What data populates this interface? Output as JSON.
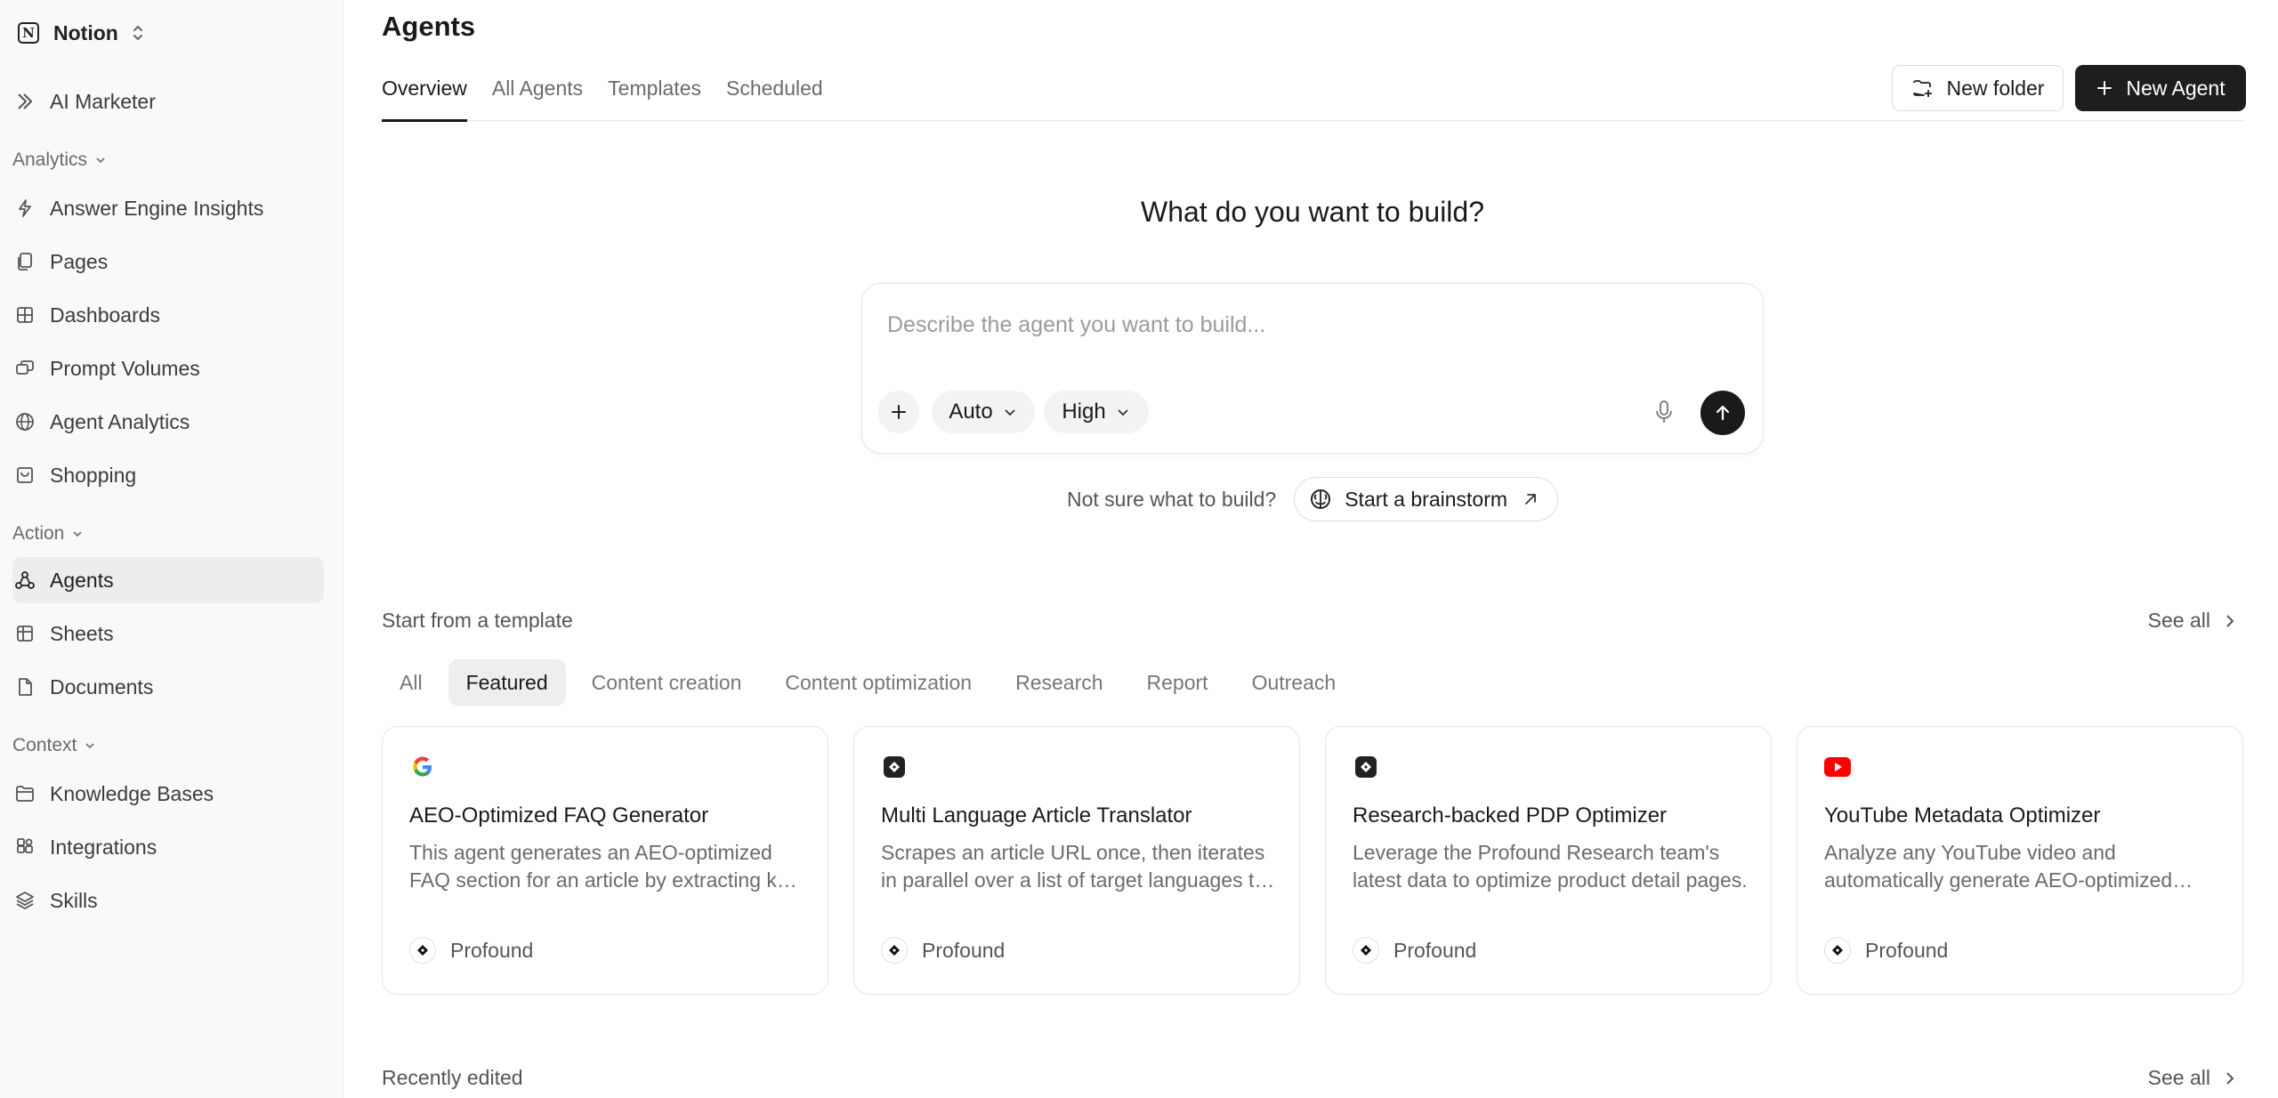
{
  "workspace": {
    "name": "Notion"
  },
  "sidebar": {
    "top_item": {
      "label": "AI Marketer",
      "icon": "profound-icon"
    },
    "sections": [
      {
        "label": "Analytics",
        "items": [
          {
            "label": "Answer Engine Insights",
            "icon": "lightning-icon"
          },
          {
            "label": "Pages",
            "icon": "pages-icon"
          },
          {
            "label": "Dashboards",
            "icon": "grid-icon"
          },
          {
            "label": "Prompt Volumes",
            "icon": "chat-icon"
          },
          {
            "label": "Agent Analytics",
            "icon": "globe-icon"
          },
          {
            "label": "Shopping",
            "icon": "bag-icon"
          }
        ]
      },
      {
        "label": "Action",
        "items": [
          {
            "label": "Agents",
            "icon": "agents-icon",
            "active": true
          },
          {
            "label": "Sheets",
            "icon": "table-icon"
          },
          {
            "label": "Documents",
            "icon": "document-icon"
          }
        ]
      },
      {
        "label": "Context",
        "items": [
          {
            "label": "Knowledge Bases",
            "icon": "folder-icon"
          },
          {
            "label": "Integrations",
            "icon": "integrations-icon"
          },
          {
            "label": "Skills",
            "icon": "layers-icon"
          }
        ]
      }
    ]
  },
  "header": {
    "title": "Agents",
    "tabs": [
      "Overview",
      "All Agents",
      "Templates",
      "Scheduled"
    ],
    "active_tab": "Overview",
    "new_folder_label": "New folder",
    "new_agent_label": "New Agent"
  },
  "builder": {
    "heading": "What do you want to build?",
    "placeholder": "Describe the agent you want to build...",
    "model_option": "Auto",
    "effort_option": "High",
    "brainstorm_question": "Not sure what to build?",
    "brainstorm_label": "Start a brainstorm"
  },
  "templates": {
    "title": "Start from a template",
    "see_all": "See all",
    "filters": [
      "All",
      "Featured",
      "Content creation",
      "Content optimization",
      "Research",
      "Report",
      "Outreach"
    ],
    "active_filter": "Featured",
    "cards": [
      {
        "title": "AEO-Optimized FAQ Generator",
        "description": "This agent generates an AEO-optimized FAQ section for an article by extracting key questions and answers.",
        "author": "Profound",
        "icon": "google-icon"
      },
      {
        "title": "Multi Language Article Translator",
        "description": "Scrapes an article URL once, then iterates in parallel over a list of target languages to translate it.",
        "author": "Profound",
        "icon": "profound-icon"
      },
      {
        "title": "Research-backed PDP Optimizer",
        "description": "Leverage the Profound Research team's latest data to optimize product detail pages.",
        "author": "Profound",
        "icon": "profound-icon"
      },
      {
        "title": "YouTube Metadata Optimizer",
        "description": "Analyze any YouTube video and automatically generate AEO-optimized metadata.",
        "author": "Profound",
        "icon": "youtube-icon"
      }
    ]
  },
  "recent": {
    "title": "Recently edited",
    "see_all": "See all"
  },
  "colors": {
    "primary_button": "#1e1e1e",
    "sidebar_bg": "#f9f9f8",
    "active_item_bg": "#ededeb",
    "youtube_red": "#ff0000"
  }
}
